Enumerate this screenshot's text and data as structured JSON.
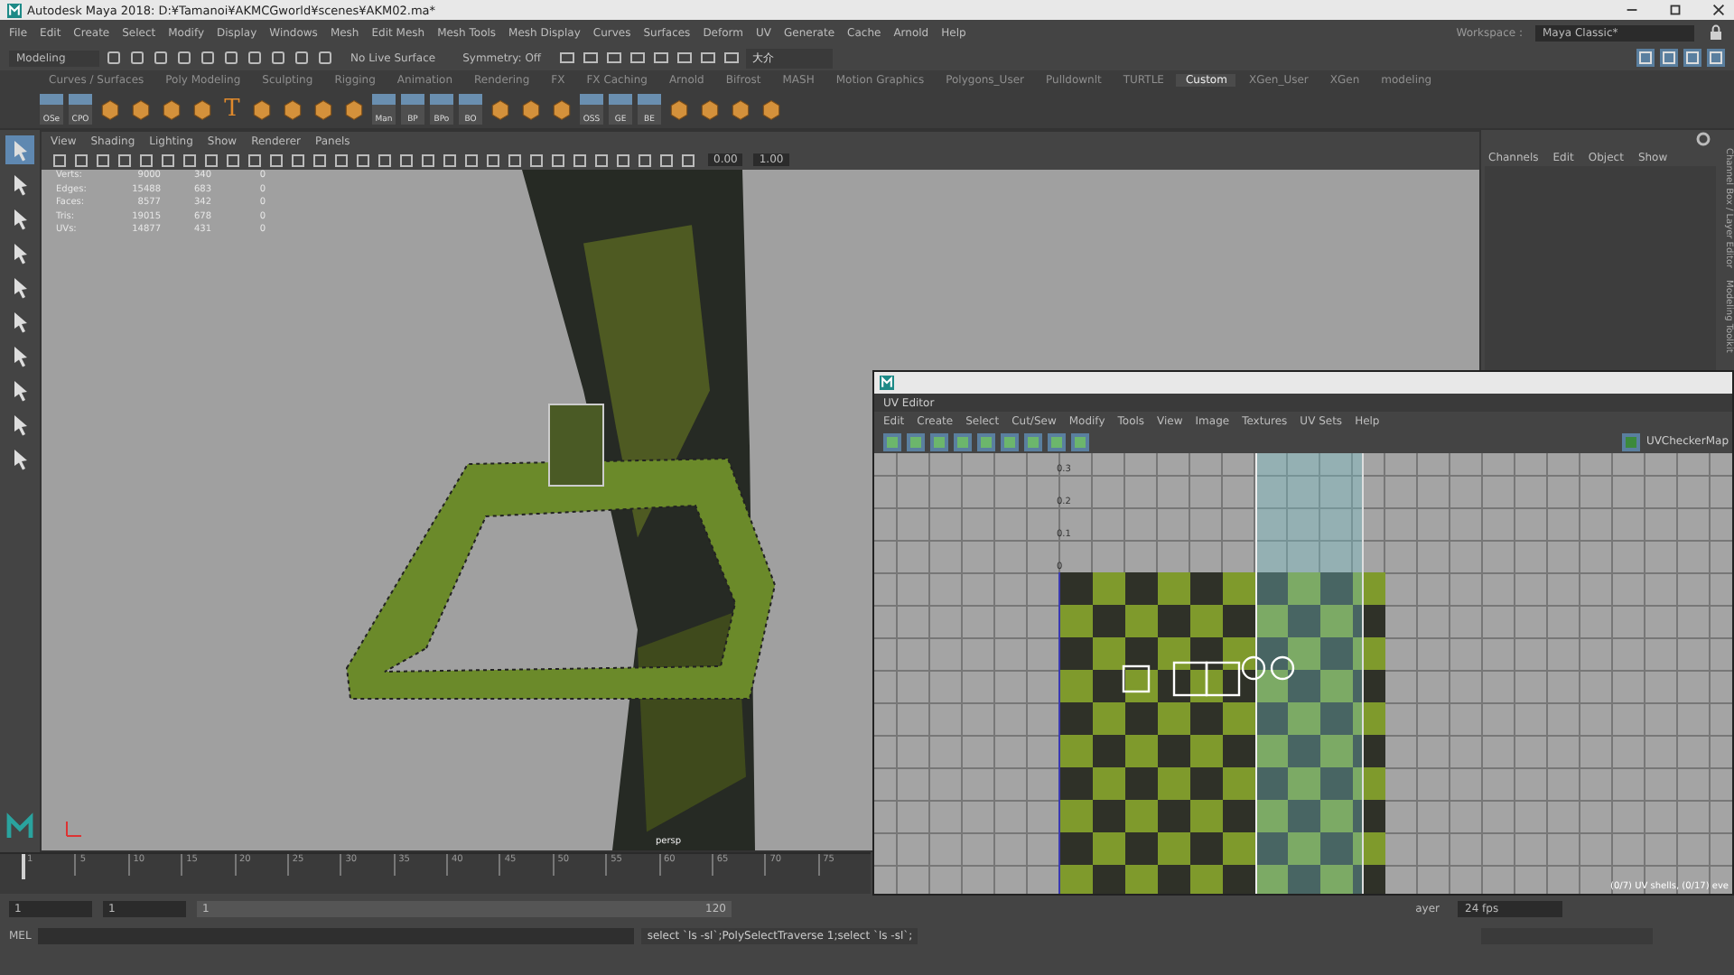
{
  "window": {
    "title": "Autodesk Maya 2018: D:¥Tamanoi¥AKMCGworld¥scenes¥AKM02.ma*"
  },
  "menu_bar": {
    "items": [
      "File",
      "Edit",
      "Create",
      "Select",
      "Modify",
      "Display",
      "Windows",
      "Mesh",
      "Edit Mesh",
      "Mesh Tools",
      "Mesh Display",
      "Curves",
      "Surfaces",
      "Deform",
      "UV",
      "Generate",
      "Cache",
      "Arnold",
      "Help"
    ],
    "workspace_label": "Workspace :",
    "workspace_value": "Maya Classic*"
  },
  "status_line": {
    "mode": "Modeling",
    "live_surface": "No Live Surface",
    "symmetry": "Symmetry: Off",
    "user": "大介"
  },
  "shelf_tabs": [
    {
      "label": "Curves / Surfaces",
      "selected": false
    },
    {
      "label": "Poly Modeling",
      "selected": false
    },
    {
      "label": "Sculpting",
      "selected": false
    },
    {
      "label": "Rigging",
      "selected": false
    },
    {
      "label": "Animation",
      "selected": false
    },
    {
      "label": "Rendering",
      "selected": false
    },
    {
      "label": "FX",
      "selected": false
    },
    {
      "label": "FX Caching",
      "selected": false
    },
    {
      "label": "Arnold",
      "selected": false
    },
    {
      "label": "Bifrost",
      "selected": false
    },
    {
      "label": "MASH",
      "selected": false
    },
    {
      "label": "Motion Graphics",
      "selected": false
    },
    {
      "label": "Polygons_User",
      "selected": false
    },
    {
      "label": "Pulldownlt",
      "selected": false
    },
    {
      "label": "TURTLE",
      "selected": false
    },
    {
      "label": "Custom",
      "selected": true
    },
    {
      "label": "XGen_User",
      "selected": false
    },
    {
      "label": "XGen",
      "selected": false
    },
    {
      "label": "modeling",
      "selected": false
    }
  ],
  "shelf_items": [
    {
      "kind": "labeled",
      "label": "OSe"
    },
    {
      "kind": "labeled",
      "label": "CPO"
    },
    {
      "kind": "icon"
    },
    {
      "kind": "icon"
    },
    {
      "kind": "icon"
    },
    {
      "kind": "icon"
    },
    {
      "kind": "text",
      "label": "T"
    },
    {
      "kind": "icon"
    },
    {
      "kind": "icon"
    },
    {
      "kind": "icon"
    },
    {
      "kind": "icon"
    },
    {
      "kind": "labeled",
      "label": "Man"
    },
    {
      "kind": "labeled",
      "label": "BP"
    },
    {
      "kind": "labeled",
      "label": "BPo"
    },
    {
      "kind": "labeled",
      "label": "BO"
    },
    {
      "kind": "icon"
    },
    {
      "kind": "icon"
    },
    {
      "kind": "icon"
    },
    {
      "kind": "labeled",
      "label": "OSS"
    },
    {
      "kind": "labeled",
      "label": "GE"
    },
    {
      "kind": "labeled",
      "label": "BE"
    },
    {
      "kind": "icon"
    },
    {
      "kind": "icon"
    },
    {
      "kind": "icon"
    },
    {
      "kind": "icon"
    }
  ],
  "toolbox": [
    {
      "selected": true
    },
    {
      "selected": false
    },
    {
      "selected": false
    },
    {
      "selected": false
    },
    {
      "selected": false
    },
    {
      "selected": false
    },
    {
      "selected": false
    },
    {
      "selected": false
    },
    {
      "selected": false
    },
    {
      "selected": false
    }
  ],
  "viewport": {
    "menus": [
      "View",
      "Shading",
      "Lighting",
      "Show",
      "Renderer",
      "Panels"
    ],
    "exposure": "0.00",
    "gamma": "1.00",
    "camera": "persp",
    "hud": [
      [
        "Verts:",
        "9000",
        "340",
        "0"
      ],
      [
        "Edges:",
        "15488",
        "683",
        "0"
      ],
      [
        "Faces:",
        "8577",
        "342",
        "0"
      ],
      [
        "Tris:",
        "19015",
        "678",
        "0"
      ],
      [
        "UVs:",
        "14877",
        "431",
        "0"
      ]
    ]
  },
  "channel_box": {
    "menus": [
      "Channels",
      "Edit",
      "Object",
      "Show"
    ],
    "side_tab": "Channel Box / Layer Editor",
    "side_tab_2": "Modeling Toolkit"
  },
  "timeline": {
    "level": 0,
    "ticks": [
      "1",
      "5",
      "10",
      "15",
      "20",
      "25",
      "30",
      "35",
      "40",
      "45",
      "50",
      "55",
      "60",
      "65",
      "70",
      "75"
    ]
  },
  "range": {
    "level": 1,
    "start": "1",
    "playback_start": "1",
    "slider_start": "1",
    "slider_end": "120"
  },
  "command_line": {
    "language": "MEL",
    "result": "select `ls -sl`;PolySelectTraverse 1;select `ls -sl`;"
  },
  "playback": {
    "layer": "ayer",
    "fps": "24 fps"
  },
  "uv_editor": {
    "title": "UV Editor",
    "menus": [
      "Edit",
      "Create",
      "Select",
      "Cut/Sew",
      "Modify",
      "Tools",
      "View",
      "Image",
      "Textures",
      "UV Sets",
      "Help"
    ],
    "texture": "UVCheckerMap",
    "axis_labels": [
      "0.3",
      "0.2",
      "0.1",
      "0"
    ],
    "status": "(0/7) UV shells, (0/17) eve"
  }
}
